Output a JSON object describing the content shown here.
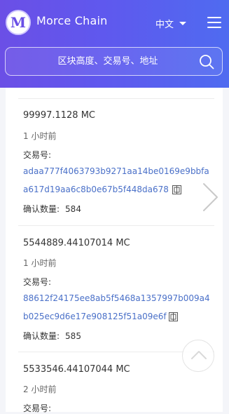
{
  "header": {
    "logo_letter": "M",
    "brand": "Morce Chain",
    "language": "中文",
    "search": {
      "placeholder": "区块高度、交易号、地址"
    }
  },
  "colors": {
    "header_gradient_start": "#6b4fe6",
    "header_gradient_end": "#4f6bf0",
    "hash_link": "#4a70c8",
    "page_background": "#f4f5f9"
  },
  "icons": {
    "logo": "logo-m",
    "language_caret": "caret-down-icon",
    "menu": "hamburger-menu-icon",
    "search": "search-icon",
    "copy": "copy-icon",
    "next": "chevron-right-icon",
    "back_to_top": "chevron-up-icon"
  },
  "transactions": [
    {
      "amount": "99997.1128 MC",
      "time": "1 小时前",
      "hash_label": "交易号:",
      "hash_line1": "adaa777f4063793b9271aa14be0169e9bbfa",
      "hash_line2": "a617d19aa6c8b0e67b5f448da678",
      "confirm_label": "确认数量:",
      "confirmations": "584"
    },
    {
      "amount": "5544889.44107014 MC",
      "time": "1 小时前",
      "hash_label": "交易号:",
      "hash_line1": "88612f24175ee8ab5f5468a1357997b009a4",
      "hash_line2": "b025ec9d6e17e908125f51a09e6f",
      "confirm_label": "确认数量:",
      "confirmations": "585"
    },
    {
      "amount": "5533546.44107044 MC",
      "time": "2 小时前",
      "hash_label": "交易号:"
    }
  ]
}
